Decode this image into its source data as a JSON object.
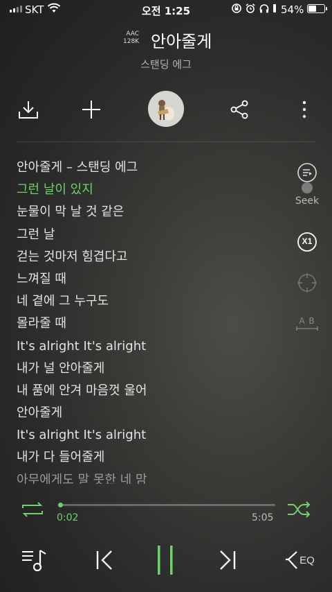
{
  "status_bar": {
    "carrier": "SKT",
    "time": "오전 1:25",
    "battery_percent": "54%",
    "battery_level": 0.54
  },
  "header": {
    "codec_line1": "AAC",
    "codec_line2": "128K",
    "title": "안아줄게",
    "artist": "스탠딩 에그"
  },
  "toolbar": {
    "icons": [
      "download-icon",
      "add-icon",
      "album-art",
      "share-icon",
      "more-icon"
    ]
  },
  "lyrics": {
    "active_index": 1,
    "lines": [
      "안아줄게 – 스탠딩 에그",
      "그런 날이 있지",
      "눈물이 막 날 것 같은",
      "그런 날",
      "걷는 것마저 힘겹다고",
      "느껴질 때",
      "네 곁에 그 누구도",
      "몰라줄 때",
      "It's alright It's alright",
      "내가 널 안아줄게",
      "내 품에 안겨 마음껏 울어",
      "안아줄게",
      "It's alright It's alright",
      "내가 다 들어줄게",
      "아무에게도 말 못한 네 맘"
    ]
  },
  "side_controls": {
    "seek_label": "Seek",
    "speed_label": "X1",
    "ab_label": "A B"
  },
  "progress": {
    "current": "0:02",
    "total": "5:05",
    "fraction": 0.007
  },
  "controls": {
    "eq_label": "EQ"
  },
  "colors": {
    "accent": "#6dd36d",
    "text": "#ffffff",
    "muted": "#b5b5b5"
  }
}
